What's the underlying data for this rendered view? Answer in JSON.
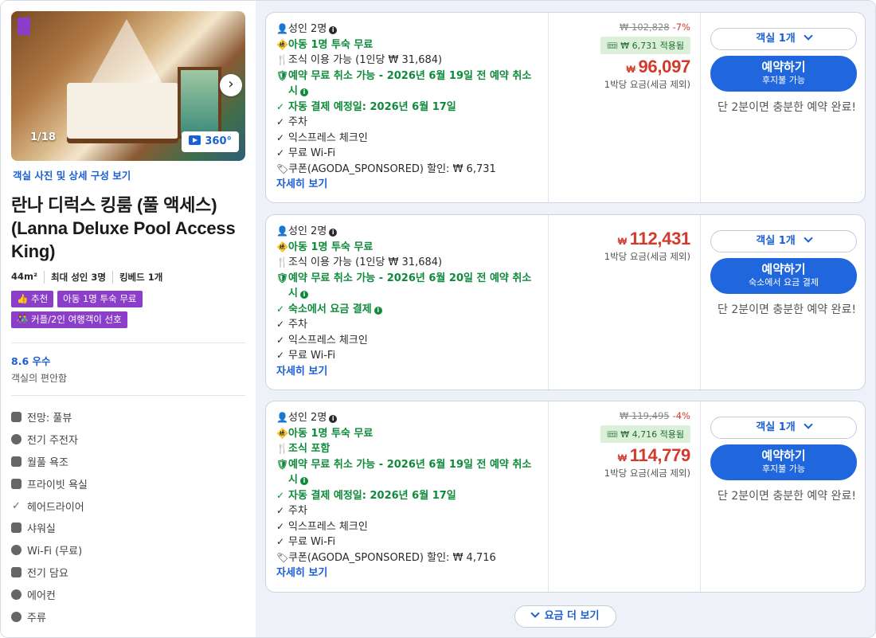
{
  "room": {
    "photo_counter": "1/18",
    "badge_360": "360°",
    "photo_link": "객실 사진 및 상세 구성 보기",
    "title": "란나 디럭스 킹룸 (풀 액세스) (Lanna Deluxe Pool Access King)",
    "specs": [
      "44m²",
      "최대 성인 3명",
      "킹베드 1개"
    ],
    "tags": [
      "추천",
      "아동 1명 투숙 무료",
      "커플/2인 여행객이 선호"
    ],
    "tag_color": "#8a3ec9",
    "rating": "8.6 우수",
    "rating_sub": "객실의 편안함",
    "amenities": [
      {
        "label": "전망: 풀뷰",
        "icon": "view-icon"
      },
      {
        "label": "전기 주전자",
        "icon": "kettle-icon"
      },
      {
        "label": "월풀 욕조",
        "icon": "bathtub-icon"
      },
      {
        "label": "프라이빗 욕실",
        "icon": "toilet-icon"
      },
      {
        "label": "헤어드라이어",
        "icon": "check-icon"
      },
      {
        "label": "샤워실",
        "icon": "shower-icon"
      },
      {
        "label": "Wi-Fi (무료)",
        "icon": "wifi-icon"
      },
      {
        "label": "전기 담요",
        "icon": "blanket-icon"
      },
      {
        "label": "에어컨",
        "icon": "snowflake-icon"
      },
      {
        "label": "주류",
        "icon": "drink-icon"
      }
    ]
  },
  "offers": [
    {
      "adults": "성인 2명",
      "child_free": "아동 1명 투숙 무료",
      "breakfast": "조식 이용 가능 (1인당 ₩ 31,684)",
      "cancel": "예약 무료 취소 가능 - 2026년 6월 19일 전 예약 취소 시",
      "payment": "자동 결제 예정일: 2026년 6월 17일",
      "parking": "주차",
      "express": "익스프레스 체크인",
      "wifi": "무료 Wi-Fi",
      "coupon": "쿠폰(AGODA_SPONSORED) 할인: ₩ 6,731",
      "details": "자세히 보기",
      "original_price": "₩ 102,828",
      "discount": "-7%",
      "coupon_applied": "₩ 6,731 적용됨",
      "currency": "₩",
      "price": "96,097",
      "per_night": "1박당 요금(세금 제외)",
      "rooms": "객실 1개",
      "book": "예약하기",
      "book_sub": "후지불 가능",
      "quick": "단 2분이면 충분한 예약 완료!"
    },
    {
      "adults": "성인 2명",
      "child_free": "아동 1명 투숙 무료",
      "breakfast": "조식 이용 가능 (1인당 ₩ 31,684)",
      "cancel": "예약 무료 취소 가능 - 2026년 6월 20일 전 예약 취소 시",
      "payment": "숙소에서 요금 결제",
      "parking": "주차",
      "express": "익스프레스 체크인",
      "wifi": "무료 Wi-Fi",
      "details": "자세히 보기",
      "currency": "₩",
      "price": "112,431",
      "per_night": "1박당 요금(세금 제외)",
      "rooms": "객실 1개",
      "book": "예약하기",
      "book_sub": "숙소에서 요금 결제",
      "quick": "단 2분이면 충분한 예약 완료!"
    },
    {
      "adults": "성인 2명",
      "child_free": "아동 1명 투숙 무료",
      "breakfast": "조식 포함",
      "cancel": "예약 무료 취소 가능 - 2026년 6월 19일 전 예약 취소 시",
      "payment": "자동 결제 예정일: 2026년 6월 17일",
      "parking": "주차",
      "express": "익스프레스 체크인",
      "wifi": "무료 Wi-Fi",
      "coupon": "쿠폰(AGODA_SPONSORED) 할인: ₩ 4,716",
      "details": "자세히 보기",
      "original_price": "₩ 119,495",
      "discount": "-4%",
      "coupon_applied": "₩ 4,716 적용됨",
      "currency": "₩",
      "price": "114,779",
      "per_night": "1박당 요금(세금 제외)",
      "rooms": "객실 1개",
      "book": "예약하기",
      "book_sub": "후지불 가능",
      "quick": "단 2분이면 충분한 예약 완료!"
    }
  ],
  "more_rates": "요금 더 보기",
  "colors": {
    "accent": "#1a5fd6",
    "button": "#2067de",
    "price": "#d33a2c",
    "green": "#0f8a3a",
    "purple": "#8a3ec9"
  }
}
